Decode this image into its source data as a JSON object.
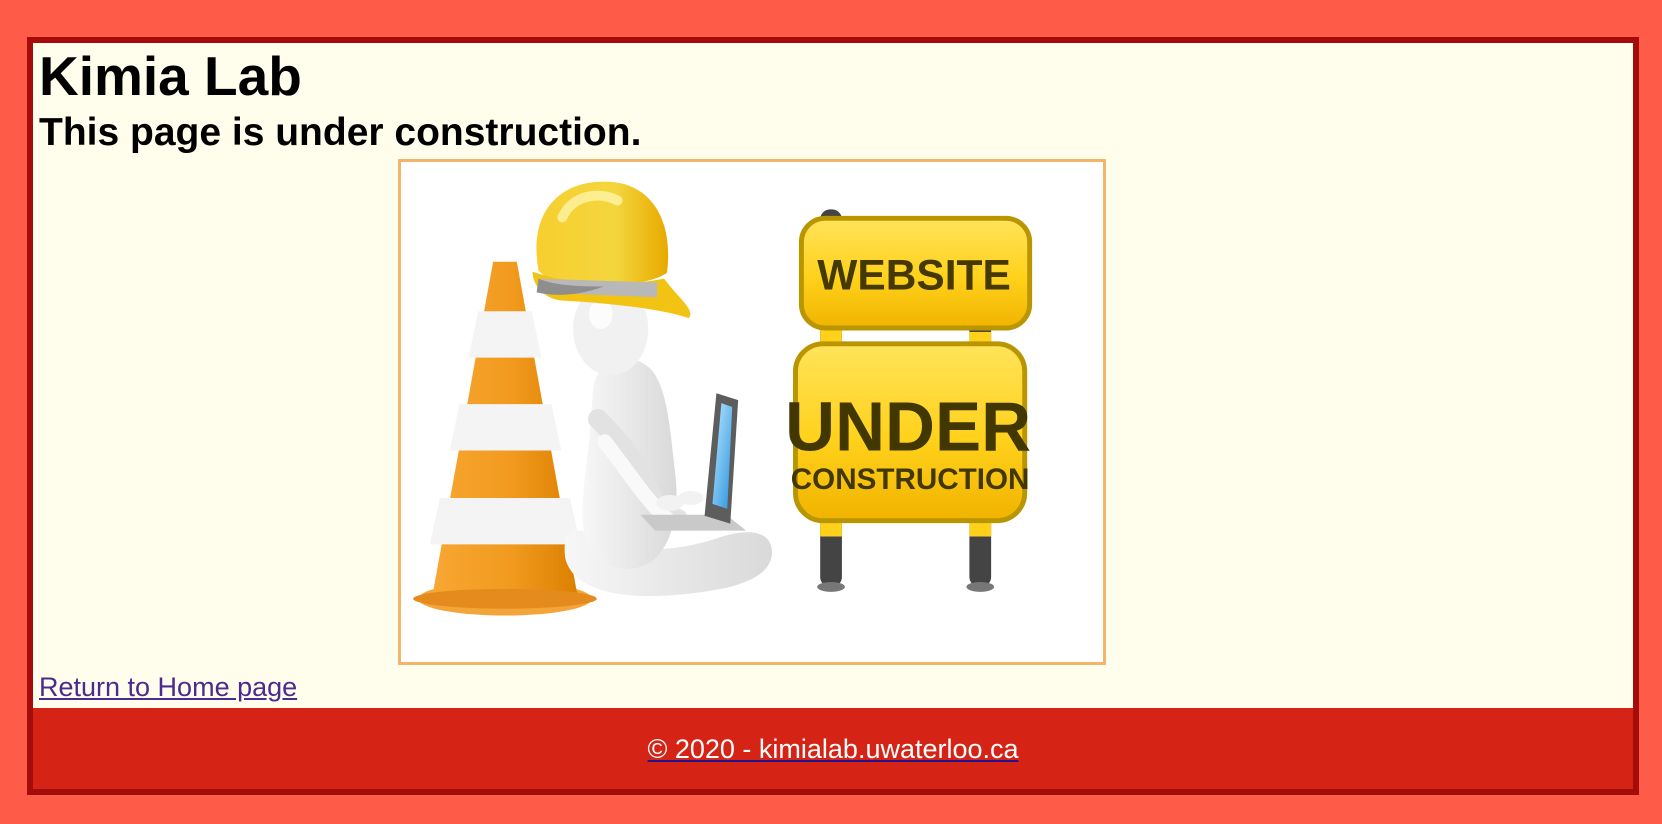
{
  "page": {
    "site_title": "Kimia Lab",
    "headline": "This page is under construction."
  },
  "illustration": {
    "image_alt": "under-construction illustration",
    "sign_top": "WEBSITE",
    "sign_bottom_1": "UNDER",
    "sign_bottom_2": "CONSTRUCTION"
  },
  "links": {
    "return_home": "Return to Home page"
  },
  "footer": {
    "copyright": "© 2020 - kimialab.uwaterloo.ca"
  },
  "colors": {
    "outer_background": "#ff5b49",
    "page_background": "#fffdec",
    "border": "#a40b0b",
    "footer_background": "#d52415",
    "image_border": "#f4b56a"
  }
}
